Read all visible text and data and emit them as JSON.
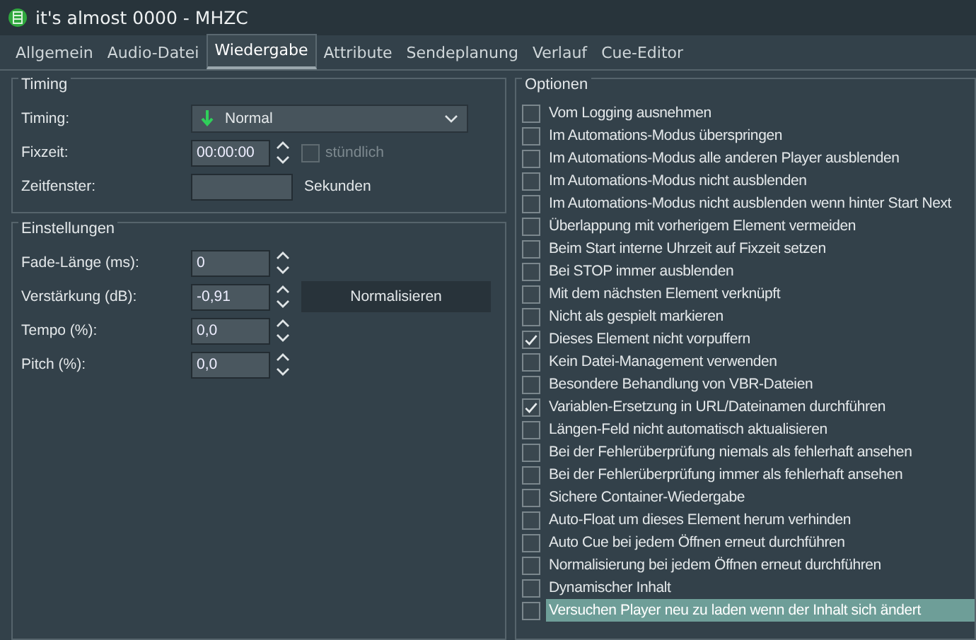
{
  "window": {
    "title": "it's almost 0000 - MHZC"
  },
  "tabs": [
    {
      "label": "Allgemein",
      "selected": false
    },
    {
      "label": "Audio-Datei",
      "selected": false
    },
    {
      "label": "Wiedergabe",
      "selected": true
    },
    {
      "label": "Attribute",
      "selected": false
    },
    {
      "label": "Sendeplanung",
      "selected": false
    },
    {
      "label": "Verlauf",
      "selected": false
    },
    {
      "label": "Cue-Editor",
      "selected": false
    }
  ],
  "timing": {
    "title": "Timing",
    "timing_label": "Timing:",
    "timing_value": "Normal",
    "fixzeit_label": "Fixzeit:",
    "fixzeit_value": "00:00:00",
    "hourly": {
      "label": "stündlich",
      "checked": false,
      "disabled": true
    },
    "zeitfenster_label": "Zeitfenster:",
    "zeitfenster_unit": "Sekunden"
  },
  "einstellungen": {
    "title": "Einstellungen",
    "fields": [
      {
        "label": "Fade-Länge (ms):",
        "value": "0"
      },
      {
        "label": "Verstärkung (dB):",
        "value": "-0,91",
        "button": "Normalisieren"
      },
      {
        "label": "Tempo (%):",
        "value": "0,0"
      },
      {
        "label": "Pitch (%):",
        "value": "0,0"
      }
    ]
  },
  "optionen": {
    "title": "Optionen",
    "items": [
      {
        "label": "Vom Logging ausnehmen",
        "checked": false,
        "selected": false
      },
      {
        "label": "Im Automations-Modus überspringen",
        "checked": false,
        "selected": false
      },
      {
        "label": "Im Automations-Modus alle anderen Player ausblenden",
        "checked": false,
        "selected": false
      },
      {
        "label": "Im Automations-Modus nicht ausblenden",
        "checked": false,
        "selected": false
      },
      {
        "label": "Im Automations-Modus nicht ausblenden wenn hinter Start Next",
        "checked": false,
        "selected": false
      },
      {
        "label": "Überlappung mit vorherigem Element vermeiden",
        "checked": false,
        "selected": false
      },
      {
        "label": "Beim Start interne Uhrzeit auf Fixzeit setzen",
        "checked": false,
        "selected": false
      },
      {
        "label": "Bei STOP immer ausblenden",
        "checked": false,
        "selected": false
      },
      {
        "label": "Mit dem nächsten Element verknüpft",
        "checked": false,
        "selected": false
      },
      {
        "label": "Nicht als gespielt markieren",
        "checked": false,
        "selected": false
      },
      {
        "label": "Dieses Element nicht vorpuffern",
        "checked": true,
        "selected": false
      },
      {
        "label": "Kein Datei-Management verwenden",
        "checked": false,
        "selected": false
      },
      {
        "label": "Besondere Behandlung von VBR-Dateien",
        "checked": false,
        "selected": false
      },
      {
        "label": "Variablen-Ersetzung in URL/Dateinamen durchführen",
        "checked": true,
        "selected": false
      },
      {
        "label": "Längen-Feld nicht automatisch aktualisieren",
        "checked": false,
        "selected": false
      },
      {
        "label": "Bei der Fehlerüberprüfung niemals als fehlerhaft ansehen",
        "checked": false,
        "selected": false
      },
      {
        "label": "Bei der Fehlerüberprüfung immer als fehlerhaft ansehen",
        "checked": false,
        "selected": false
      },
      {
        "label": "Sichere Container-Wiedergabe",
        "checked": false,
        "selected": false
      },
      {
        "label": "Auto-Float um dieses Element herum verhinden",
        "checked": false,
        "selected": false
      },
      {
        "label": "Auto Cue bei jedem Öffnen erneut durchführen",
        "checked": false,
        "selected": false
      },
      {
        "label": "Normalisierung bei jedem Öffnen erneut durchführen",
        "checked": false,
        "selected": false
      },
      {
        "label": "Dynamischer Inhalt",
        "checked": false,
        "selected": false
      },
      {
        "label": "Versuchen Player neu zu laden wenn der Inhalt sich ändert",
        "checked": false,
        "selected": true
      }
    ]
  }
}
